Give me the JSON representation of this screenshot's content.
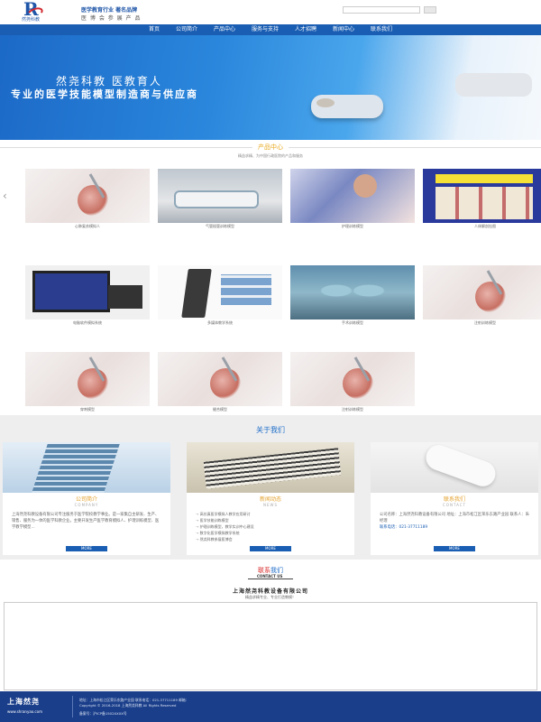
{
  "header": {
    "logo_name": "然尧科教",
    "slogan_line1": "医学教育行业  著名品牌",
    "slogan_line2": "医 博 会 参 展 产 品",
    "search_placeholder": ""
  },
  "nav": [
    "首页",
    "公司简介",
    "产品中心",
    "服务与支持",
    "人才招聘",
    "新闻中心",
    "联系我们"
  ],
  "banner": {
    "line1": "然尧科教  医教育人",
    "line2": "专业的医学技能模型制造商与供应商",
    "dot_count": 3
  },
  "products": {
    "title": "产品中心",
    "subtitle": "精益求精、为中国行政医院的产品和服务",
    "items": [
      {
        "caption": "心肺复苏模拟人",
        "image": "needle"
      },
      {
        "caption": "气管插管训练模型",
        "image": "lab"
      },
      {
        "caption": "护理训练模型",
        "image": "nurse"
      },
      {
        "caption": "人体解剖挂图",
        "image": "chart"
      },
      {
        "caption": "电脑软件模拟系统",
        "image": "monitor"
      },
      {
        "caption": "多媒体教学系统",
        "image": "kiosk"
      },
      {
        "caption": "手术训练模型",
        "image": "surgery"
      },
      {
        "caption": "注射训练模型",
        "image": "needle"
      },
      {
        "caption": "穿刺模型",
        "image": "needle"
      },
      {
        "caption": "缝合模型",
        "image": "needle"
      },
      {
        "caption": "注射训练模型",
        "image": "needle"
      }
    ]
  },
  "about": {
    "title": "关于我们",
    "columns": [
      {
        "heading": "公司简介",
        "sub": "COMPANY",
        "text": "上海然尧科教设备有限公司专注服务于医学院校教学事业。是一家集自主研发、生产、销售、服务为一体的医学科教企业。主要开发生产医学教育模拟人、护理训练模型、医学教学模型...",
        "more": "MORE"
      },
      {
        "heading": "新闻动态",
        "sub": "NEWS",
        "news": [
          "高仿真医学模拟人教学应用研讨",
          "医学技能训练模型",
          "护理训练模型，教学实训中心建设",
          "数字化医学模拟教学系统",
          "然尧科教参展医博会"
        ],
        "more": "MORE"
      },
      {
        "heading": "联系我们",
        "sub": "CONTACT",
        "text": "公司名称：上海然尧科教设备有限公司 地址：上海市松江区荣乐东路产业园 联系人：朱经理",
        "phone": "联系电话：021-37711189",
        "more": "MORE"
      }
    ]
  },
  "contact": {
    "title_red": "联系",
    "title_blue": "我们",
    "en": "CONTACT US",
    "company": "上海然尧科教设备有限公司",
    "note": "精益求精专业、专业打造教模！"
  },
  "footer": {
    "logo_text": "上海然尧",
    "url": "www.shranyao.com",
    "line1": "地址：上海市松江区荣乐东路产业园    联系电话：021-37711189    邮箱：",
    "line2": "Copyright © 2016-2018 上海然尧科教 All Rights Reserved",
    "line3": "备案号：沪ICP备1502XXXX号"
  },
  "colors": {
    "nav_bg": "#1a5eb3",
    "accent_gold": "#e8a81e",
    "footer_bg": "#1a3e8a",
    "contact_red": "#d82a2a"
  }
}
